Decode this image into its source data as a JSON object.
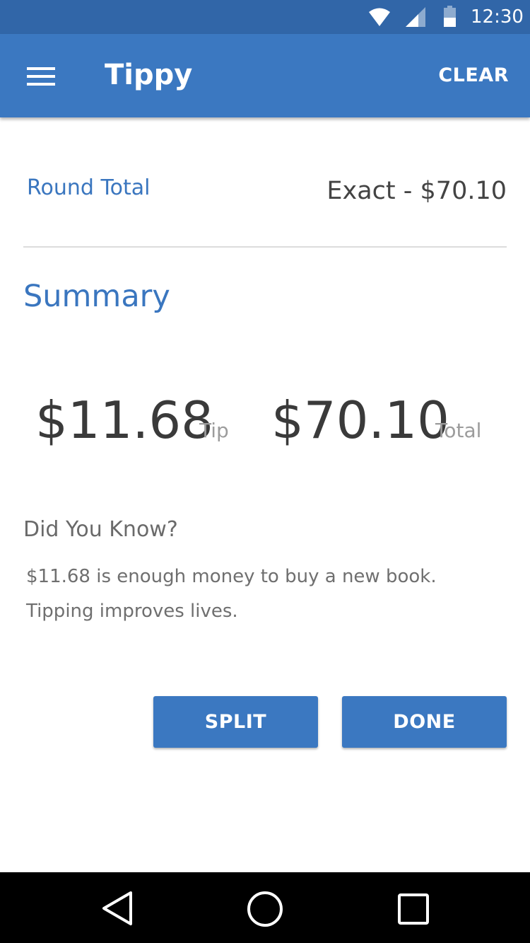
{
  "status_bar": {
    "time": "12:30",
    "icons": [
      "wifi-icon",
      "signal-icon",
      "battery-icon"
    ]
  },
  "app_bar": {
    "title": "Tippy",
    "clear_label": "CLEAR",
    "menu_icon": "menu-icon"
  },
  "rounding": {
    "label": "Round Total",
    "value": "Exact - $70.10"
  },
  "summary": {
    "heading": "Summary",
    "tip_amount": "$11.68",
    "tip_label": "Tip",
    "total_amount": "$70.10",
    "total_label": "Total"
  },
  "did_you_know": {
    "heading": "Did You Know?",
    "lines": [
      "$11.68 is enough money to buy a new book.",
      "Tipping improves lives."
    ]
  },
  "actions": {
    "split_label": "SPLIT",
    "done_label": "DONE"
  },
  "nav_bar": {
    "icons": [
      "back-icon",
      "home-icon",
      "recents-icon"
    ]
  },
  "colors": {
    "status_bar": "#3166a8",
    "primary": "#3b78c1",
    "accent_text": "#3a76bf",
    "nav_bar": "#000000"
  }
}
